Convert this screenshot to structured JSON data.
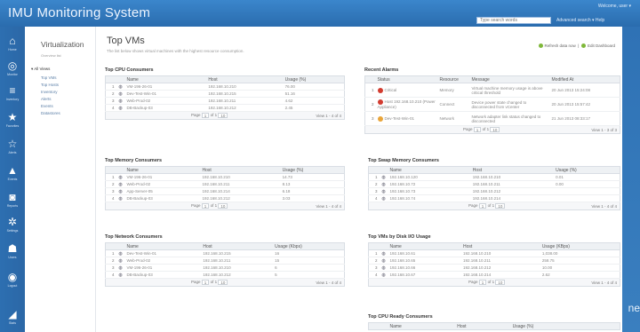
{
  "app": {
    "title": "IMU Monitoring System",
    "welcome": "Welcome, user ▾",
    "search_placeholder": "Type search words",
    "top_link": "Advanced search ▾ Help"
  },
  "rail": [
    {
      "icon": "home-icon",
      "glyph": "⌂",
      "label": "Home"
    },
    {
      "icon": "monitor-icon",
      "glyph": "◎",
      "label": "Monitor"
    },
    {
      "icon": "list-icon",
      "glyph": "≡",
      "label": "Inventory"
    },
    {
      "icon": "star-icon",
      "glyph": "★",
      "label": "Favorites"
    },
    {
      "icon": "star-outline-icon",
      "glyph": "☆",
      "label": "Alerts"
    },
    {
      "icon": "warning-icon",
      "glyph": "▲",
      "label": "Events"
    },
    {
      "icon": "camera-icon",
      "glyph": "◙",
      "label": "Reports"
    },
    {
      "icon": "gear-icon",
      "glyph": "✲",
      "label": "Settings"
    },
    {
      "icon": "users-icon",
      "glyph": "☗",
      "label": "Users"
    },
    {
      "icon": "power-icon",
      "glyph": "◉",
      "label": "Logout"
    },
    {
      "icon": "chart-icon",
      "glyph": "◢",
      "label": "Stats"
    }
  ],
  "subnav": {
    "title": "Virtualization",
    "subtitle": "Overview list",
    "group": "▾ All Views",
    "links": [
      "Top VMs",
      "Top Hosts",
      "Inventory",
      "Alerts",
      "Events",
      "Datastores"
    ]
  },
  "page": {
    "title": "Top VMs",
    "description": "The list below shows virtual machines with the highest resource consumption.",
    "action_refresh": "Refresh data now",
    "action_settings": "Edit Dashboard"
  },
  "cpu": {
    "title": "Top CPU Consumers",
    "headers": [
      "Name",
      "Host",
      "Usage (%)"
    ],
    "rows": [
      {
        "idx": "1",
        "name": "VM-196-26-01",
        "host": "192.168.10.210",
        "usage": "76.00"
      },
      {
        "idx": "2",
        "name": "Dev-Test-Win-01",
        "host": "192.168.10.215",
        "usage": "51.16"
      },
      {
        "idx": "3",
        "name": "Web-Prod-02",
        "host": "192.168.10.211",
        "usage": "4.62"
      },
      {
        "idx": "4",
        "name": "DB-Backup-03",
        "host": "192.168.10.212",
        "usage": "2.45"
      }
    ],
    "pager": {
      "page_label": "Page",
      "page": "1",
      "of": "of 1",
      "per_page": "10",
      "info": "View 1 - 4 of 4"
    }
  },
  "alerts": {
    "title": "Recent Alarms",
    "headers": [
      "Status",
      "Resource",
      "Message",
      "Modified At"
    ],
    "rows": [
      {
        "idx": "1",
        "color": "#d23b2f",
        "status": "Critical",
        "resource": "Memory",
        "message": "Virtual machine memory usage is above critical threshold",
        "time": "20 Jun 2013 15:24:08"
      },
      {
        "idx": "2",
        "color": "#d23b2f",
        "status": "Host 192.168.10.210 (Power Appliance)",
        "resource": "Connect",
        "message": "Device power state changed to disconnected from vCenter",
        "time": "20 Jun 2013 15:57:42"
      },
      {
        "idx": "3",
        "color": "#e9a53a",
        "status": "Dev-Test-Win-01",
        "resource": "Network",
        "message": "Network adapter link status changed to disconnected",
        "time": "21 Jun 2013 08:33:17"
      }
    ],
    "pager": {
      "page_label": "Page",
      "page": "1",
      "of": "of 1",
      "per_page": "10",
      "info": "View 1 - 3 of 3"
    }
  },
  "memory": {
    "title": "Top Memory Consumers",
    "headers": [
      "Name",
      "Host",
      "Usage (%)"
    ],
    "rows": [
      {
        "idx": "1",
        "name": "VM-196-26-01",
        "host": "192.168.10.210",
        "usage": "14.73"
      },
      {
        "idx": "2",
        "name": "Web-Prod-02",
        "host": "192.168.10.211",
        "usage": "8.13"
      },
      {
        "idx": "3",
        "name": "App-Server-05",
        "host": "192.168.10.214",
        "usage": "6.18"
      },
      {
        "idx": "4",
        "name": "DB-Backup-03",
        "host": "192.168.10.212",
        "usage": "3.03"
      }
    ],
    "pager": {
      "page_label": "Page",
      "page": "1",
      "of": "of 1",
      "per_page": "10",
      "info": "View 1 - 4 of 4"
    }
  },
  "swap": {
    "title": "Top Swap Memory Consumers",
    "headers": [
      "Name",
      "Host",
      "Usage (%)"
    ],
    "rows": [
      {
        "idx": "1",
        "name": "192.168.10.120",
        "host": "192.168.10.210",
        "usage": "0.01"
      },
      {
        "idx": "2",
        "name": "192.168.10.72",
        "host": "192.168.10.211",
        "usage": "0.00"
      },
      {
        "idx": "3",
        "name": "192.168.10.73",
        "host": "192.168.10.212",
        "usage": ""
      },
      {
        "idx": "4",
        "name": "192.168.10.74",
        "host": "192.168.10.214",
        "usage": ""
      }
    ],
    "pager": {
      "page_label": "Page",
      "page": "1",
      "of": "of 1",
      "per_page": "10",
      "info": "View 1 - 4 of 4"
    }
  },
  "network": {
    "title": "Top Network Consumers",
    "headers": [
      "Name",
      "Host",
      "Usage (Kbps)"
    ],
    "rows": [
      {
        "idx": "1",
        "name": "Dev-Test-Win-01",
        "host": "192.168.10.215",
        "usage": "16"
      },
      {
        "idx": "2",
        "name": "Web-Prod-02",
        "host": "192.168.10.211",
        "usage": "15"
      },
      {
        "idx": "3",
        "name": "VM-196-26-01",
        "host": "192.168.10.210",
        "usage": "6"
      },
      {
        "idx": "4",
        "name": "DB-Backup-03",
        "host": "192.168.10.212",
        "usage": "5"
      }
    ],
    "pager": {
      "page_label": "Page",
      "page": "1",
      "of": "of 1",
      "per_page": "10",
      "info": "View 1 - 4 of 4"
    }
  },
  "disk": {
    "title": "Top VMs by Disk I/O Usage",
    "headers": [
      "Name",
      "Host",
      "Usage (KBps)"
    ],
    "rows": [
      {
        "idx": "1",
        "name": "192.168.10.61",
        "host": "192.168.10.210",
        "usage": "1,038.00"
      },
      {
        "idx": "2",
        "name": "192.168.10.65",
        "host": "192.168.10.211",
        "usage": "258.75"
      },
      {
        "idx": "3",
        "name": "192.168.10.66",
        "host": "192.168.10.212",
        "usage": "10.00"
      },
      {
        "idx": "4",
        "name": "192.168.10.67",
        "host": "192.168.10.214",
        "usage": "2.62"
      }
    ],
    "pager": {
      "page_label": "Page",
      "page": "1",
      "of": "of 1",
      "per_page": "10",
      "info": "View 1 - 4 of 4"
    }
  },
  "cpuready": {
    "title": "Top CPU Ready Consumers",
    "headers": [
      "Name",
      "Host",
      "Usage (%)"
    ]
  },
  "edge_text": "ne"
}
